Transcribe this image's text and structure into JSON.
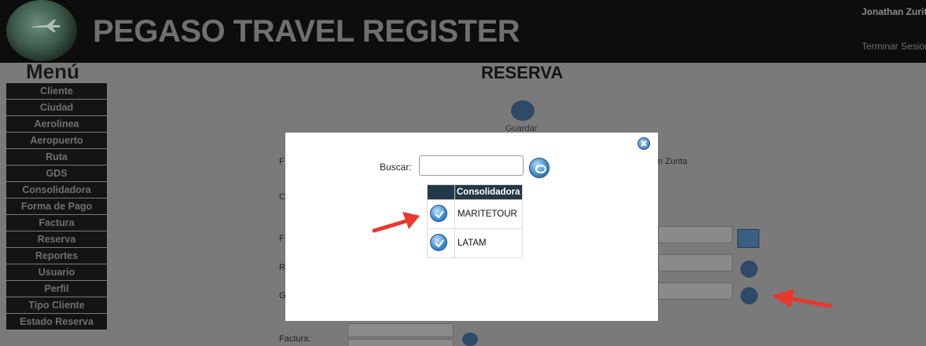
{
  "header": {
    "title": "PEGASO TRAVEL REGISTER",
    "user_name": "Jonathan Zurita",
    "logout_label": "Terminar Sesión"
  },
  "menu": {
    "title": "Menú",
    "items": [
      "Cliente",
      "Ciudad",
      "Aerolinea",
      "Aeropuerto",
      "Ruta",
      "GDS",
      "Consolidadora",
      "Forma de Pago",
      "Factura",
      "Reserva",
      "Reportes",
      "Usuario",
      "Perfil",
      "Tipo Cliente",
      "Estado Reserva"
    ]
  },
  "main": {
    "title": "RESERVA",
    "save_label": "Guardar",
    "bg_labels": {
      "a": "F",
      "b": "C",
      "c": "F",
      "d": "R",
      "e": "G",
      "user_partial": "n Zurita",
      "factura": "Factura:"
    }
  },
  "modal": {
    "search_label": "Buscar:",
    "search_value": "",
    "table": {
      "header": "Consolidadora",
      "rows": [
        "MARITETOUR",
        "LATAM"
      ]
    }
  },
  "colors": {
    "header_bg": "#0d0d0d",
    "overlay_bg": "#7a7a7a",
    "table_header": "#223747",
    "arrow": "#e8392e"
  }
}
